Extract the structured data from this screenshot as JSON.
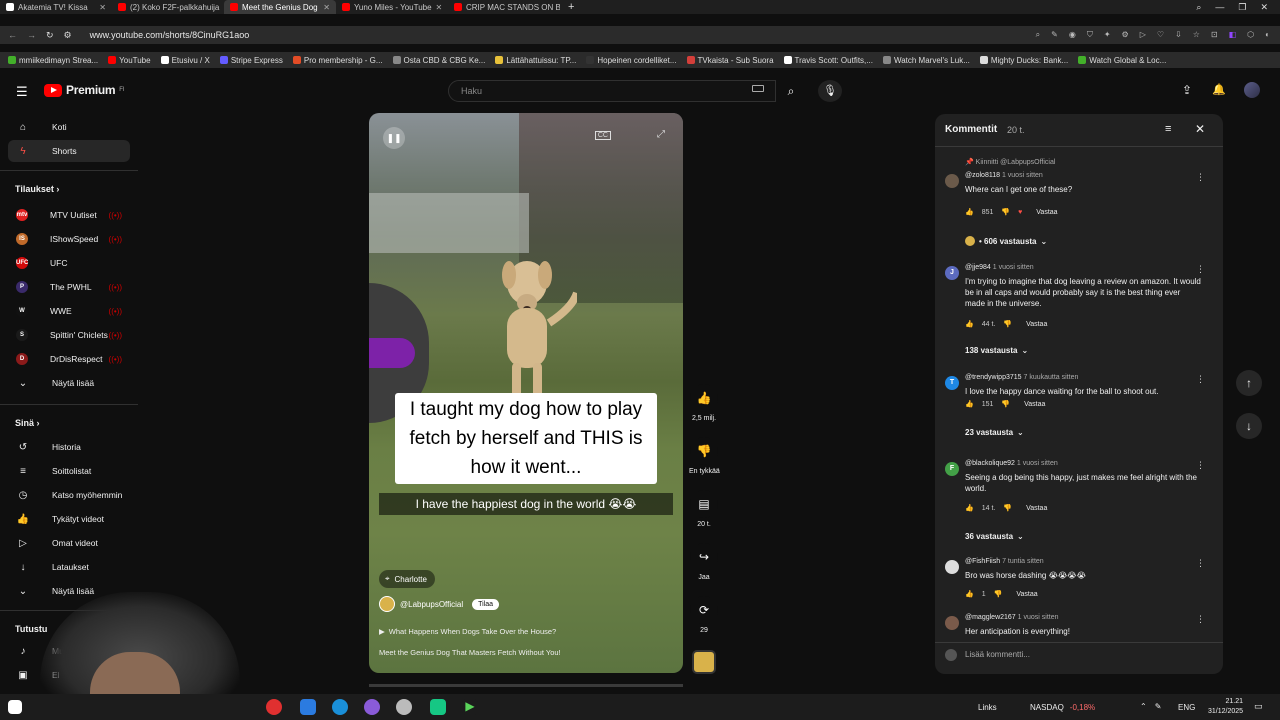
{
  "browser": {
    "tabs": [
      {
        "label": "Akatemia TV! Kissa",
        "color": "#ffffff"
      },
      {
        "label": "(2) Koko F2F-palkkahuija",
        "color": "#ff0000"
      },
      {
        "label": "Meet the Genius Dog",
        "color": "#ff0000"
      },
      {
        "label": "Yuno Miles - YouTube",
        "color": "#ff0000"
      },
      {
        "label": "CRIP MAC STANDS ON BU",
        "color": "#ff0000"
      }
    ],
    "url": "www.youtube.com/shorts/8CinuRG1aoo",
    "bookmarks": [
      {
        "label": "mmiikedimayn Strea...",
        "color": "#9146ff"
      },
      {
        "label": "YouTube",
        "color": "#ff0000"
      },
      {
        "label": "Etusivu / X",
        "color": "#ffffff"
      },
      {
        "label": "Stripe Express",
        "color": "#635bff"
      },
      {
        "label": "Pro membership - G...",
        "color": "#e34c26"
      },
      {
        "label": "Osta CBD & CBG Ke...",
        "color": "#888888"
      },
      {
        "label": "Lättähattuissu: TP...",
        "color": "#e8c13a"
      },
      {
        "label": "Hopeinen cordelliket...",
        "color": "#333333"
      },
      {
        "label": "TVkaista - Sub Suora",
        "color": "#d43f3a"
      },
      {
        "label": "Travis Scott: Outfits,...",
        "color": "#ffffff"
      },
      {
        "label": "Watch Marvel's Luk...",
        "color": "#888888"
      },
      {
        "label": "Mighty Ducks: Bank...",
        "color": "#dddddd"
      },
      {
        "label": "Watch Global & Loc...",
        "color": "#43b02a"
      }
    ]
  },
  "youtube": {
    "logo": "Premium",
    "logo_sup": "FI",
    "search_placeholder": "Haku",
    "sidebar": {
      "home": "Koti",
      "shorts": "Shorts",
      "subscriptions_title": "Tilaukset",
      "subscriptions": [
        {
          "label": "MTV Uutiset",
          "color": "#e02020",
          "abbr": "mtv"
        },
        {
          "label": "IShowSpeed",
          "color": "#c06a2a",
          "abbr": "IS"
        },
        {
          "label": "UFC",
          "color": "#d20a0a",
          "abbr": "UFC"
        },
        {
          "label": "The PWHL",
          "color": "#3a2a6a",
          "abbr": "P"
        },
        {
          "label": "WWE",
          "color": "#111111",
          "abbr": "W"
        },
        {
          "label": "Spittin' Chiclets",
          "color": "#1a1a1a",
          "abbr": "S"
        },
        {
          "label": "DrDisRespect",
          "color": "#8b1a1a",
          "abbr": "D"
        }
      ],
      "show_more": "Näytä lisää",
      "you_title": "Sinä",
      "you_items": [
        {
          "label": "Historia",
          "icon": "history-icon",
          "glyph": "↺"
        },
        {
          "label": "Soittolistat",
          "icon": "playlists-icon",
          "glyph": "≡"
        },
        {
          "label": "Katso myöhemmin",
          "icon": "clock-icon",
          "glyph": "◷"
        },
        {
          "label": "Tykätyt videot",
          "icon": "like-icon",
          "glyph": "👍"
        },
        {
          "label": "Omat videot",
          "icon": "my-videos-icon",
          "glyph": "▷"
        },
        {
          "label": "Lataukset",
          "icon": "download-icon",
          "glyph": "↓"
        },
        {
          "label": "Näytä lisää",
          "icon": "chevron-down-icon",
          "glyph": "⌄"
        }
      ],
      "explore_title": "Tutustu",
      "explore_items": [
        {
          "label": "Mu",
          "icon": "music-icon",
          "glyph": "♪"
        },
        {
          "label": "El",
          "icon": "film-icon",
          "glyph": "▣"
        }
      ]
    },
    "short": {
      "caption": "I taught my dog how to play fetch by herself and THIS is how it went...",
      "subcaption": "I have the happiest dog in the world 😭😭",
      "location": "Charlotte",
      "channel": "@LabpupsOfficial",
      "subscribe": "Tilaa",
      "music": "What Happens When Dogs Take Over the House?",
      "title": "Meet the Genius Dog That Masters Fetch Without You!",
      "progress": 0.0
    },
    "actions": {
      "likes": "2,5 milj.",
      "dislike": "En tykkää",
      "comments": "20 t.",
      "share": "Jaa",
      "remix": "29"
    },
    "comments_panel": {
      "title": "Kommentit",
      "count": "20 t.",
      "pinned_by": "Kiinnitti @LabpupsOfficial",
      "items": [
        {
          "user": "@zolo8118",
          "time": "1 vuosi sitten",
          "text": "Where can I get one of these?",
          "likes": "851",
          "reply": "Vastaa",
          "replies": "• 606 vastausta",
          "avatar_color": "#6b5a4a",
          "initial": ""
        },
        {
          "user": "@jje984",
          "time": "1 vuosi sitten",
          "text": "I'm trying to imagine that dog leaving a review on amazon. It would be in all caps and would probably say it is the best thing ever made in the universe.",
          "likes": "44 t.",
          "reply": "Vastaa",
          "replies": "138 vastausta",
          "avatar_color": "#5c6bc0",
          "initial": "J"
        },
        {
          "user": "@trendywipp3715",
          "time": "7 kuukautta sitten",
          "text": "I love the happy dance waiting for the ball to shoot out.",
          "likes": "151",
          "reply": "Vastaa",
          "replies": "23 vastausta",
          "avatar_color": "#1e88e5",
          "initial": "T"
        },
        {
          "user": "@blackolique92",
          "time": "1 vuosi sitten",
          "text": "Seeing a dog being this happy, just makes me feel alright with the world.",
          "likes": "14 t.",
          "reply": "Vastaa",
          "replies": "36 vastausta",
          "avatar_color": "#43a047",
          "initial": "F"
        },
        {
          "user": "@FishFiish",
          "time": "7 tuntia sitten",
          "text": "Bro was horse dashing 😭😭😭😭",
          "likes": "1",
          "reply": "Vastaa",
          "replies": "",
          "avatar_color": "#dddddd",
          "initial": ""
        },
        {
          "user": "@magglew2167",
          "time": "1 vuosi sitten",
          "text": "Her anticipation is everything!",
          "likes": "",
          "reply": "",
          "replies": "",
          "avatar_color": "#7a5a4a",
          "initial": ""
        }
      ],
      "input_placeholder": "Lisää kommentti..."
    }
  },
  "taskbar": {
    "links": "Links",
    "ticker": "NASDAQ",
    "ticker_change": "-0,18%",
    "lang": "ENG",
    "time": "21.21",
    "date": "31/12/2025"
  }
}
